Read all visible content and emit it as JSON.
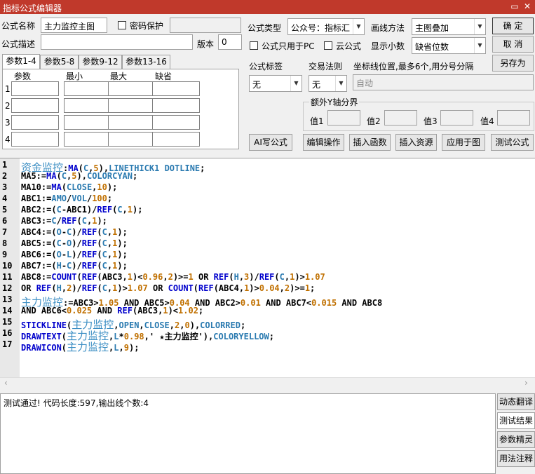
{
  "window": {
    "title": "指标公式编辑器",
    "min": "▭",
    "close": "✕"
  },
  "form": {
    "name_label": "公式名称",
    "name_value": "主力监控主图",
    "password_label": "密码保护",
    "desc_label": "公式描述",
    "desc_value": "",
    "version_label": "版本",
    "version_value": "0",
    "type_label": "公式类型",
    "type_value": "公众号：指标汇",
    "draw_label": "画线方法",
    "draw_value": "主图叠加",
    "pc_only_label": "公式只用于PC",
    "cloud_label": "云公式",
    "decimals_label": "显示小数",
    "decimals_value": "缺省位数",
    "tag_label": "公式标签",
    "tag_value": "无",
    "trade_label": "交易法则",
    "trade_value": "无",
    "coord_label": "坐标线位置,最多6个,用分号分隔",
    "coord_placeholder": "自动",
    "yaxis_label": "额外Y轴分界",
    "y_values": [
      "值1",
      "值2",
      "值3",
      "值4"
    ]
  },
  "buttons": {
    "ok": "确  定",
    "cancel": "取  消",
    "save_as": "另存为",
    "ai": "AI写公式",
    "edit_ops": "编辑操作",
    "insert_func": "插入函数",
    "insert_res": "插入资源",
    "apply": "应用于图",
    "test": "测试公式"
  },
  "tabs": [
    "参数1-4",
    "参数5-8",
    "参数9-12",
    "参数13-16"
  ],
  "params": {
    "headers": [
      "参数",
      "最小",
      "最大",
      "缺省"
    ],
    "rows": [
      "1",
      "2",
      "3",
      "4"
    ]
  },
  "code_lines": [
    [
      [
        "cn",
        "资金监控"
      ],
      [
        "t",
        ":"
      ],
      [
        "fn",
        "MA"
      ],
      [
        "t",
        "("
      ],
      [
        "kw",
        "C"
      ],
      [
        "t",
        ","
      ],
      [
        "num",
        "5"
      ],
      [
        "t",
        "),"
      ],
      [
        "kw",
        "LINETHICK1 DOTLINE"
      ],
      [
        "t",
        ";"
      ]
    ],
    [
      [
        "t",
        "MA5:="
      ],
      [
        "fn",
        "MA"
      ],
      [
        "t",
        "("
      ],
      [
        "kw",
        "C"
      ],
      [
        "t",
        ","
      ],
      [
        "num",
        "5"
      ],
      [
        "t",
        "),"
      ],
      [
        "kw",
        "COLORCYAN"
      ],
      [
        "t",
        ";"
      ]
    ],
    [
      [
        "t",
        "MA10:="
      ],
      [
        "fn",
        "MA"
      ],
      [
        "t",
        "("
      ],
      [
        "kw",
        "CLOSE"
      ],
      [
        "t",
        ","
      ],
      [
        "num",
        "10"
      ],
      [
        "t",
        ");"
      ]
    ],
    [
      [
        "t",
        "ABC1:="
      ],
      [
        "kw",
        "AMO"
      ],
      [
        "t",
        "/"
      ],
      [
        "kw",
        "VOL"
      ],
      [
        "t",
        "/"
      ],
      [
        "num",
        "100"
      ],
      [
        "t",
        ";"
      ]
    ],
    [
      [
        "t",
        "ABC2:=("
      ],
      [
        "kw",
        "C"
      ],
      [
        "t",
        "-ABC1)/"
      ],
      [
        "fn",
        "REF"
      ],
      [
        "t",
        "("
      ],
      [
        "kw",
        "C"
      ],
      [
        "t",
        ","
      ],
      [
        "num",
        "1"
      ],
      [
        "t",
        ");"
      ]
    ],
    [
      [
        "t",
        "ABC3:="
      ],
      [
        "kw",
        "C"
      ],
      [
        "t",
        "/"
      ],
      [
        "fn",
        "REF"
      ],
      [
        "t",
        "("
      ],
      [
        "kw",
        "C"
      ],
      [
        "t",
        ","
      ],
      [
        "num",
        "1"
      ],
      [
        "t",
        ");"
      ]
    ],
    [
      [
        "t",
        "ABC4:=("
      ],
      [
        "kw",
        "O"
      ],
      [
        "t",
        "-"
      ],
      [
        "kw",
        "C"
      ],
      [
        "t",
        ")/"
      ],
      [
        "fn",
        "REF"
      ],
      [
        "t",
        "("
      ],
      [
        "kw",
        "C"
      ],
      [
        "t",
        ","
      ],
      [
        "num",
        "1"
      ],
      [
        "t",
        ");"
      ]
    ],
    [
      [
        "t",
        "ABC5:=("
      ],
      [
        "kw",
        "C"
      ],
      [
        "t",
        "-"
      ],
      [
        "kw",
        "O"
      ],
      [
        "t",
        ")/"
      ],
      [
        "fn",
        "REF"
      ],
      [
        "t",
        "("
      ],
      [
        "kw",
        "C"
      ],
      [
        "t",
        ","
      ],
      [
        "num",
        "1"
      ],
      [
        "t",
        ");"
      ]
    ],
    [
      [
        "t",
        "ABC6:=("
      ],
      [
        "kw",
        "O"
      ],
      [
        "t",
        "-"
      ],
      [
        "kw",
        "L"
      ],
      [
        "t",
        ")/"
      ],
      [
        "fn",
        "REF"
      ],
      [
        "t",
        "("
      ],
      [
        "kw",
        "C"
      ],
      [
        "t",
        ","
      ],
      [
        "num",
        "1"
      ],
      [
        "t",
        ");"
      ]
    ],
    [
      [
        "t",
        "ABC7:=("
      ],
      [
        "kw",
        "H"
      ],
      [
        "t",
        "-"
      ],
      [
        "kw",
        "C"
      ],
      [
        "t",
        ")/"
      ],
      [
        "fn",
        "REF"
      ],
      [
        "t",
        "("
      ],
      [
        "kw",
        "C"
      ],
      [
        "t",
        ","
      ],
      [
        "num",
        "1"
      ],
      [
        "t",
        ");"
      ]
    ],
    [
      [
        "t",
        "ABC8:="
      ],
      [
        "fn",
        "COUNT"
      ],
      [
        "t",
        "("
      ],
      [
        "fn",
        "REF"
      ],
      [
        "t",
        "(ABC3,"
      ],
      [
        "num",
        "1"
      ],
      [
        "t",
        ")<"
      ],
      [
        "num",
        "0.96"
      ],
      [
        "t",
        ","
      ],
      [
        "num",
        "2"
      ],
      [
        "t",
        ")>="
      ],
      [
        "num",
        "1"
      ],
      [
        "t",
        " OR "
      ],
      [
        "fn",
        "REF"
      ],
      [
        "t",
        "("
      ],
      [
        "kw",
        "H"
      ],
      [
        "t",
        ","
      ],
      [
        "num",
        "3"
      ],
      [
        "t",
        ")/"
      ],
      [
        "fn",
        "REF"
      ],
      [
        "t",
        "("
      ],
      [
        "kw",
        "C"
      ],
      [
        "t",
        ","
      ],
      [
        "num",
        "1"
      ],
      [
        "t",
        ")>"
      ],
      [
        "num",
        "1.07"
      ]
    ],
    [
      [
        "t",
        "OR "
      ],
      [
        "fn",
        "REF"
      ],
      [
        "t",
        "("
      ],
      [
        "kw",
        "H"
      ],
      [
        "t",
        ","
      ],
      [
        "num",
        "2"
      ],
      [
        "t",
        ")/"
      ],
      [
        "fn",
        "REF"
      ],
      [
        "t",
        "("
      ],
      [
        "kw",
        "C"
      ],
      [
        "t",
        ","
      ],
      [
        "num",
        "1"
      ],
      [
        "t",
        ")>"
      ],
      [
        "num",
        "1.07"
      ],
      [
        "t",
        " OR "
      ],
      [
        "fn",
        "COUNT"
      ],
      [
        "t",
        "("
      ],
      [
        "fn",
        "REF"
      ],
      [
        "t",
        "(ABC4,"
      ],
      [
        "num",
        "1"
      ],
      [
        "t",
        ")>"
      ],
      [
        "num",
        "0.04"
      ],
      [
        "t",
        ","
      ],
      [
        "num",
        "2"
      ],
      [
        "t",
        ")>="
      ],
      [
        "num",
        "1"
      ],
      [
        "t",
        ";"
      ]
    ],
    [
      [
        "cn",
        "主力监控"
      ],
      [
        "t",
        ":=ABC3>"
      ],
      [
        "num",
        "1.05"
      ],
      [
        "t",
        " AND ABC5>"
      ],
      [
        "num",
        "0.04"
      ],
      [
        "t",
        " AND ABC2>"
      ],
      [
        "num",
        "0.01"
      ],
      [
        "t",
        " AND ABC7<"
      ],
      [
        "num",
        "0.015"
      ],
      [
        "t",
        " AND ABC8"
      ]
    ],
    [
      [
        "t",
        "AND ABC6<"
      ],
      [
        "num",
        "0.025"
      ],
      [
        "t",
        " AND "
      ],
      [
        "fn",
        "REF"
      ],
      [
        "t",
        "(ABC3,"
      ],
      [
        "num",
        "1"
      ],
      [
        "t",
        ")<"
      ],
      [
        "num",
        "1.02"
      ],
      [
        "t",
        ";"
      ]
    ],
    [
      [
        "fn",
        "STICKLINE"
      ],
      [
        "t",
        "("
      ],
      [
        "cn",
        "主力监控"
      ],
      [
        "t",
        ","
      ],
      [
        "kw",
        "OPEN"
      ],
      [
        "t",
        ","
      ],
      [
        "kw",
        "CLOSE"
      ],
      [
        "t",
        ","
      ],
      [
        "num",
        "2"
      ],
      [
        "t",
        ","
      ],
      [
        "num",
        "0"
      ],
      [
        "t",
        "),"
      ],
      [
        "kw",
        "COLORRED"
      ],
      [
        "t",
        ";"
      ]
    ],
    [
      [
        "fn",
        "DRAWTEXT"
      ],
      [
        "t",
        "("
      ],
      [
        "cn",
        "主力监控"
      ],
      [
        "t",
        ","
      ],
      [
        "kw",
        "L"
      ],
      [
        "t",
        "*"
      ],
      [
        "num",
        "0.98"
      ],
      [
        "t",
        ",' "
      ],
      [
        "str",
        "★主力监控"
      ],
      [
        "t",
        "'),"
      ],
      [
        "kw",
        "COLORYELLOW"
      ],
      [
        "t",
        ";"
      ]
    ],
    [
      [
        "fn",
        "DRAWICON"
      ],
      [
        "t",
        "("
      ],
      [
        "cn",
        "主力监控"
      ],
      [
        "t",
        ","
      ],
      [
        "kw",
        "L"
      ],
      [
        "t",
        ","
      ],
      [
        "num",
        "9"
      ],
      [
        "t",
        ");"
      ]
    ]
  ],
  "line_numbers": [
    "1",
    "2",
    "3",
    "4",
    "5",
    "6",
    "7",
    "8",
    "9",
    "10",
    "11",
    "12",
    "13",
    "14",
    "15",
    "16",
    "17"
  ],
  "status_text": "测试通过! 代码长度:597,输出线个数:4",
  "side_buttons": [
    "动态翻译",
    "测试结果",
    "参数精灵",
    "用法注释"
  ],
  "scroll": {
    "left": "‹",
    "right": "›"
  }
}
